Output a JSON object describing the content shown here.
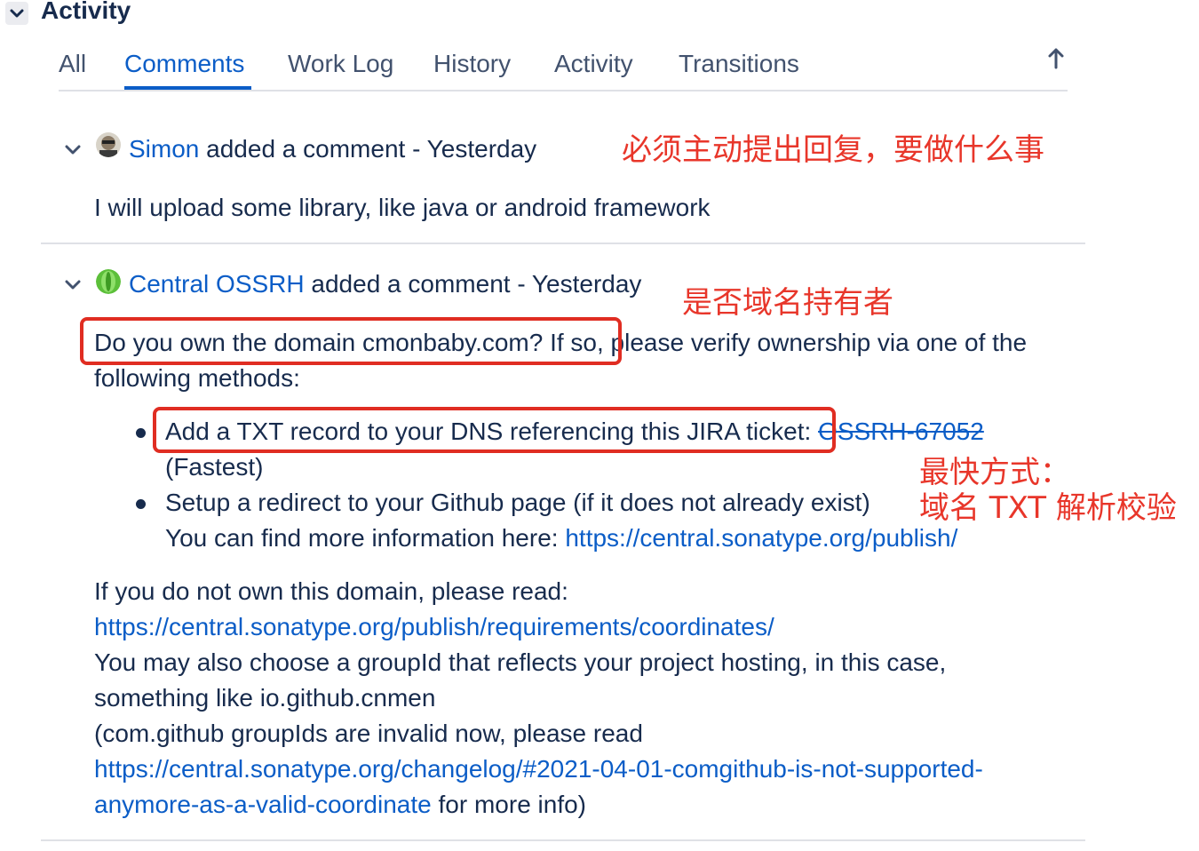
{
  "section": {
    "title": "Activity",
    "toggle_icon": "chevron-down-icon"
  },
  "tabs": [
    {
      "label": "All"
    },
    {
      "label": "Comments",
      "active": true
    },
    {
      "label": "Work Log"
    },
    {
      "label": "History"
    },
    {
      "label": "Activity"
    },
    {
      "label": "Transitions"
    }
  ],
  "sort_icon": "arrow-up-icon",
  "comments": [
    {
      "author": "Simon",
      "action": " added a comment - ",
      "time": "Yesterday",
      "body": "I will upload some library, like java or android framework"
    },
    {
      "author": "Central OSSRH",
      "action": " added a comment - ",
      "time": "Yesterday",
      "line1": "Do you own the domain cmonbaby.com? If so, please verify ownership via one of the",
      "line2": "following methods:",
      "bullet1_text": "Add a TXT record to your DNS referencing this JIRA ticket: ",
      "bullet1_link": "OSSRH-67052",
      "bullet1_line2": "(Fastest)",
      "bullet2_text": "Setup a redirect to your Github page (if it does not already exist)",
      "bullet2_line2": "You can find more information here: ",
      "bullet2_link": "https://central.sonatype.org/publish/",
      "p1": "If you do not own this domain, please read:",
      "p1_link": "https://central.sonatype.org/publish/requirements/coordinates/",
      "p2_line1": "You may also choose a groupId that reflects your project hosting, in this case,",
      "p2_line2": "something like io.github.cnmen",
      "p2_line3": "(com.github groupIds are invalid now, please read",
      "p2_link_line1": "https://central.sonatype.org/changelog/#2021-04-01-comgithub-is-not-supported-",
      "p2_link_line2": "anymore-as-a-valid-coordinate",
      "p2_tail": " for more info)"
    }
  ],
  "annotations": {
    "a1": "必须主动提出回复，要做什么事",
    "a2": "是否域名持有者",
    "a3_line1": "最快方式：",
    "a3_line2": "域名 TXT 解析校验"
  },
  "colors": {
    "link": "#0b5dc7",
    "text": "#172b4d",
    "annotation": "#e8362a"
  }
}
